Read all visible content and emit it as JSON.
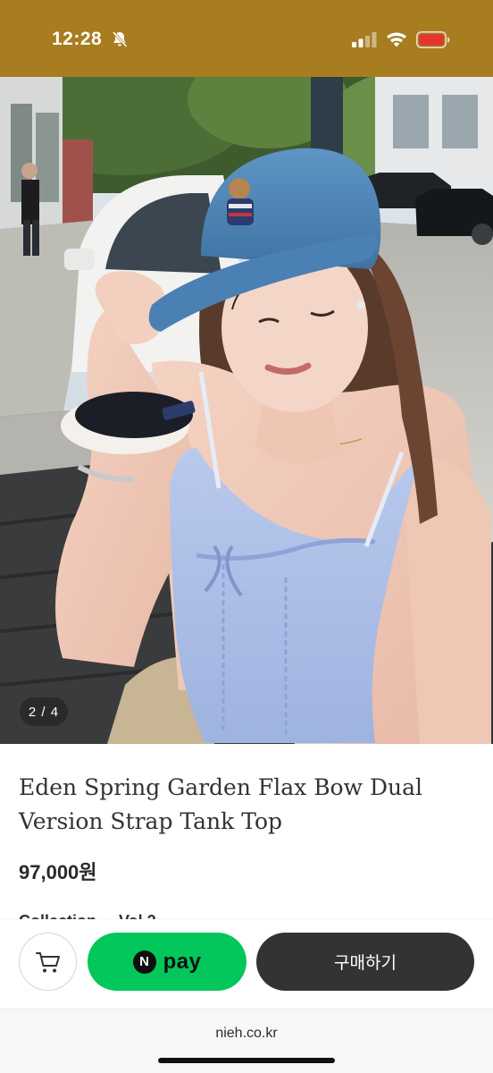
{
  "status_bar": {
    "time": "12:28",
    "icons": [
      "bell-slash-icon",
      "cellular-signal-icon",
      "wifi-icon",
      "battery-low-icon"
    ],
    "background": "#a77d20",
    "battery_color": "#e5362d"
  },
  "product": {
    "image": {
      "description_icon": "product-photo",
      "page_counter": "2 / 4"
    },
    "title": "Eden Spring Garden Flax Bow Dual Version Strap Tank Top",
    "price": "97,000원",
    "collection_peek": "Collection ... Vol.2"
  },
  "purchase_bar": {
    "cart_icon": "shopping-cart-icon",
    "npay": {
      "logo": "N",
      "label": "pay",
      "color": "#03c75a"
    },
    "buy_label": "구매하기",
    "buy_color": "#333333"
  },
  "browser": {
    "domain": "nieh.co.kr"
  }
}
